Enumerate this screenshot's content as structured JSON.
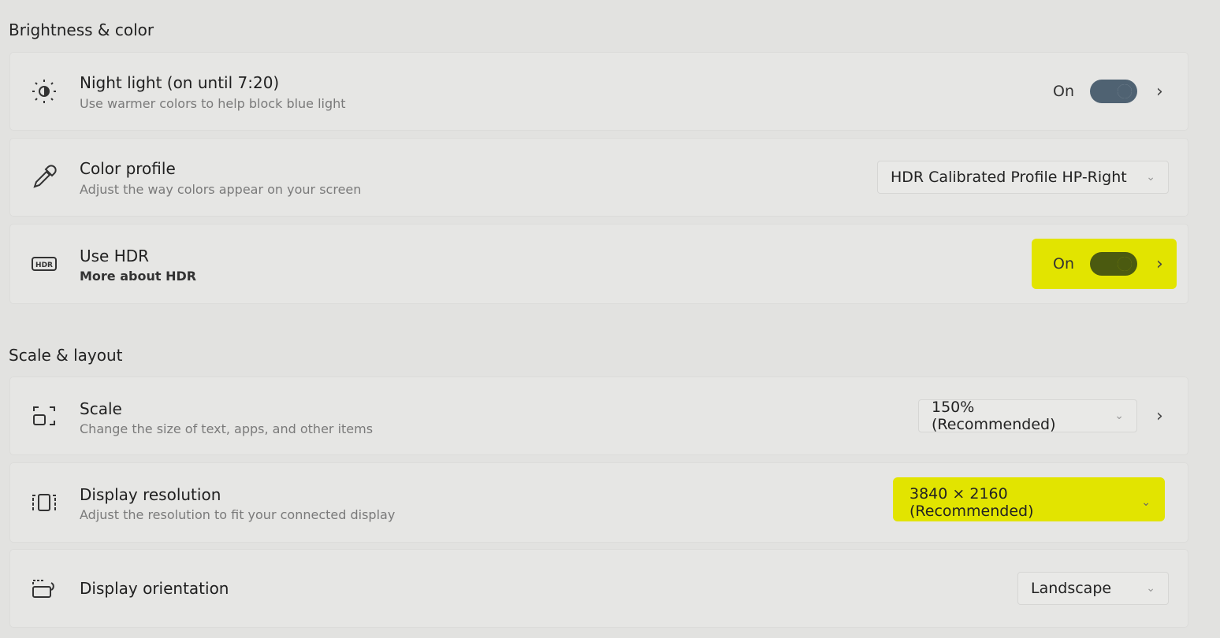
{
  "sections": [
    {
      "title": "Brightness & color"
    },
    {
      "title": "Scale & layout"
    }
  ],
  "night_light": {
    "icon": "brightness-icon",
    "title": "Night light (on until 7:20)",
    "subtitle": "Use warmer colors to help block blue light",
    "state": "On",
    "on": true
  },
  "color_profile": {
    "icon": "eyedropper-icon",
    "title": "Color profile",
    "subtitle": "Adjust the way colors appear on your screen",
    "value": "HDR Calibrated Profile HP-Right"
  },
  "hdr": {
    "icon": "hdr-icon",
    "title": "Use HDR",
    "link": "More about HDR",
    "state": "On",
    "on": true
  },
  "scale": {
    "icon": "scale-icon",
    "title": "Scale",
    "subtitle": "Change the size of text, apps, and other items",
    "value": "150% (Recommended)"
  },
  "resolution": {
    "icon": "resolution-icon",
    "title": "Display resolution",
    "subtitle": "Adjust the resolution to fit your connected display",
    "value": "3840 × 2160 (Recommended)"
  },
  "orientation": {
    "icon": "orientation-icon",
    "title": "Display orientation",
    "value": "Landscape"
  },
  "colors": {
    "highlight": "#e2e400",
    "toggle_on": "#4f6272",
    "toggle_on_highlighted": "#4b5a10"
  }
}
